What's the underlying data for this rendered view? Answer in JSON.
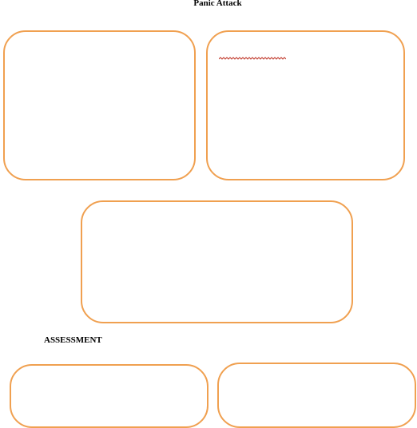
{
  "document": {
    "title": "Panic Attack",
    "assessment_heading": "ASSESSMENT"
  },
  "colors": {
    "box_border": "#f0a050",
    "spellcheck_squiggle": "#c0392b"
  },
  "icons": {
    "spellcheck_marker": "spellcheck-squiggle-icon"
  }
}
